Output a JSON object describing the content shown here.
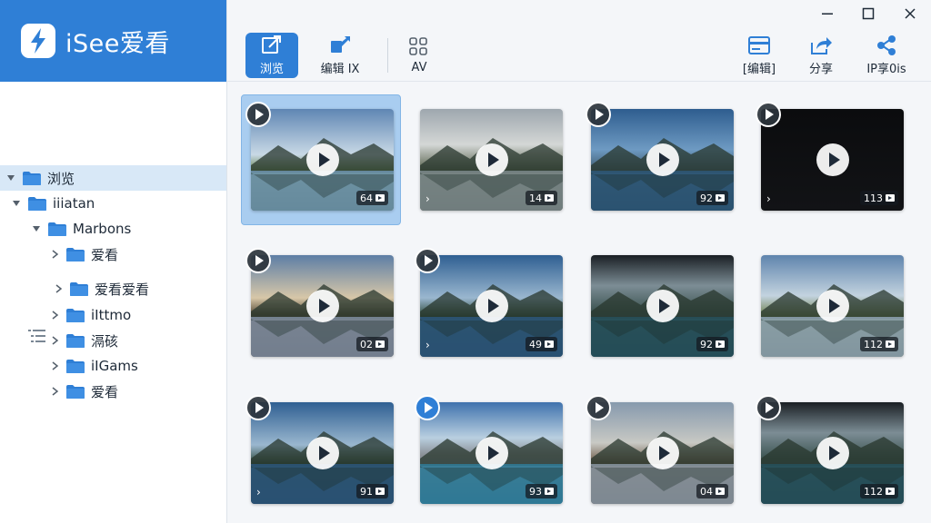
{
  "app": {
    "name": "iSee爱看"
  },
  "sidebar": {
    "tree": [
      {
        "label": "浏览",
        "level": 0,
        "expanded": true,
        "selected": true
      },
      {
        "label": "iiiatan",
        "level": 0,
        "expanded": true,
        "selected": false
      },
      {
        "label": "Marbons",
        "level": 1,
        "expanded": true,
        "selected": false
      },
      {
        "label": "爱看",
        "level": 2,
        "expanded": false,
        "selected": false
      },
      {
        "label": "爱看爱看",
        "level": 2,
        "expanded": false,
        "selected": false
      },
      {
        "label": "iIttmo",
        "level": 2,
        "expanded": false,
        "selected": false
      },
      {
        "label": "滆硋",
        "level": 2,
        "expanded": false,
        "selected": false
      },
      {
        "label": "iIGams",
        "level": 2,
        "expanded": false,
        "selected": false
      },
      {
        "label": "爱看",
        "level": 2,
        "expanded": false,
        "selected": false
      }
    ],
    "list_icon": "list-icon"
  },
  "toolbar": {
    "browse": "浏览",
    "edit": "编辑 IX",
    "av": "AV",
    "edit_right": "[编辑]",
    "share": "分享",
    "share_more": "IP享0is"
  },
  "colors": {
    "accent": "#2f7fd6",
    "selected_row": "#d8e8f7",
    "selected_card": "#a9cdf0"
  },
  "videos": [
    {
      "badge": "64",
      "selected": true,
      "scene": "river",
      "corner": "dark",
      "chevron": false
    },
    {
      "badge": "14",
      "selected": false,
      "scene": "canyon",
      "corner": "none",
      "chevron": true
    },
    {
      "badge": "92",
      "selected": false,
      "scene": "lakeblue",
      "corner": "dark",
      "chevron": false
    },
    {
      "badge": "113",
      "selected": false,
      "scene": "black",
      "corner": "dark",
      "chevron": true
    },
    {
      "badge": "02",
      "selected": false,
      "scene": "dusk",
      "corner": "dark",
      "chevron": false
    },
    {
      "badge": "49",
      "selected": false,
      "scene": "lake",
      "corner": "dark",
      "chevron": true
    },
    {
      "badge": "92",
      "selected": false,
      "scene": "fjord",
      "corner": "none",
      "chevron": false
    },
    {
      "badge": "112",
      "selected": false,
      "scene": "meadow",
      "corner": "none",
      "chevron": false
    },
    {
      "badge": "91",
      "selected": false,
      "scene": "lake",
      "corner": "dark",
      "chevron": true
    },
    {
      "badge": "93",
      "selected": false,
      "scene": "peaks",
      "corner": "blue",
      "chevron": false
    },
    {
      "badge": "04",
      "selected": false,
      "scene": "rocks",
      "corner": "dark",
      "chevron": false
    },
    {
      "badge": "112",
      "selected": false,
      "scene": "fjord",
      "corner": "dark",
      "chevron": false
    }
  ]
}
